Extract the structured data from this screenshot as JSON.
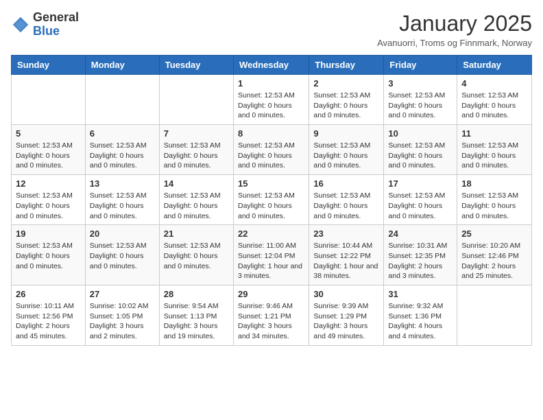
{
  "logo": {
    "general": "General",
    "blue": "Blue"
  },
  "header": {
    "title": "January 2025",
    "subtitle": "Avanuorri, Troms og Finnmark, Norway"
  },
  "weekdays": [
    "Sunday",
    "Monday",
    "Tuesday",
    "Wednesday",
    "Thursday",
    "Friday",
    "Saturday"
  ],
  "weeks": [
    [
      {
        "day": "",
        "info": ""
      },
      {
        "day": "",
        "info": ""
      },
      {
        "day": "",
        "info": ""
      },
      {
        "day": "1",
        "info": "Sunset: 12:53 AM\nDaylight: 0 hours and 0 minutes."
      },
      {
        "day": "2",
        "info": "Sunset: 12:53 AM\nDaylight: 0 hours and 0 minutes."
      },
      {
        "day": "3",
        "info": "Sunset: 12:53 AM\nDaylight: 0 hours and 0 minutes."
      },
      {
        "day": "4",
        "info": "Sunset: 12:53 AM\nDaylight: 0 hours and 0 minutes."
      }
    ],
    [
      {
        "day": "5",
        "info": "Sunset: 12:53 AM\nDaylight: 0 hours and 0 minutes."
      },
      {
        "day": "6",
        "info": "Sunset: 12:53 AM\nDaylight: 0 hours and 0 minutes."
      },
      {
        "day": "7",
        "info": "Sunset: 12:53 AM\nDaylight: 0 hours and 0 minutes."
      },
      {
        "day": "8",
        "info": "Sunset: 12:53 AM\nDaylight: 0 hours and 0 minutes."
      },
      {
        "day": "9",
        "info": "Sunset: 12:53 AM\nDaylight: 0 hours and 0 minutes."
      },
      {
        "day": "10",
        "info": "Sunset: 12:53 AM\nDaylight: 0 hours and 0 minutes."
      },
      {
        "day": "11",
        "info": "Sunset: 12:53 AM\nDaylight: 0 hours and 0 minutes."
      }
    ],
    [
      {
        "day": "12",
        "info": "Sunset: 12:53 AM\nDaylight: 0 hours and 0 minutes."
      },
      {
        "day": "13",
        "info": "Sunset: 12:53 AM\nDaylight: 0 hours and 0 minutes."
      },
      {
        "day": "14",
        "info": "Sunset: 12:53 AM\nDaylight: 0 hours and 0 minutes."
      },
      {
        "day": "15",
        "info": "Sunset: 12:53 AM\nDaylight: 0 hours and 0 minutes."
      },
      {
        "day": "16",
        "info": "Sunset: 12:53 AM\nDaylight: 0 hours and 0 minutes."
      },
      {
        "day": "17",
        "info": "Sunset: 12:53 AM\nDaylight: 0 hours and 0 minutes."
      },
      {
        "day": "18",
        "info": "Sunset: 12:53 AM\nDaylight: 0 hours and 0 minutes."
      }
    ],
    [
      {
        "day": "19",
        "info": "Sunset: 12:53 AM\nDaylight: 0 hours and 0 minutes."
      },
      {
        "day": "20",
        "info": "Sunset: 12:53 AM\nDaylight: 0 hours and 0 minutes."
      },
      {
        "day": "21",
        "info": "Sunset: 12:53 AM\nDaylight: 0 hours and 0 minutes."
      },
      {
        "day": "22",
        "info": "Sunrise: 11:00 AM\nSunset: 12:04 PM\nDaylight: 1 hour and 3 minutes."
      },
      {
        "day": "23",
        "info": "Sunrise: 10:44 AM\nSunset: 12:22 PM\nDaylight: 1 hour and 38 minutes."
      },
      {
        "day": "24",
        "info": "Sunrise: 10:31 AM\nSunset: 12:35 PM\nDaylight: 2 hours and 3 minutes."
      },
      {
        "day": "25",
        "info": "Sunrise: 10:20 AM\nSunset: 12:46 PM\nDaylight: 2 hours and 25 minutes."
      }
    ],
    [
      {
        "day": "26",
        "info": "Sunrise: 10:11 AM\nSunset: 12:56 PM\nDaylight: 2 hours and 45 minutes."
      },
      {
        "day": "27",
        "info": "Sunrise: 10:02 AM\nSunset: 1:05 PM\nDaylight: 3 hours and 2 minutes."
      },
      {
        "day": "28",
        "info": "Sunrise: 9:54 AM\nSunset: 1:13 PM\nDaylight: 3 hours and 19 minutes."
      },
      {
        "day": "29",
        "info": "Sunrise: 9:46 AM\nSunset: 1:21 PM\nDaylight: 3 hours and 34 minutes."
      },
      {
        "day": "30",
        "info": "Sunrise: 9:39 AM\nSunset: 1:29 PM\nDaylight: 3 hours and 49 minutes."
      },
      {
        "day": "31",
        "info": "Sunrise: 9:32 AM\nSunset: 1:36 PM\nDaylight: 4 hours and 4 minutes."
      },
      {
        "day": "",
        "info": ""
      }
    ]
  ]
}
